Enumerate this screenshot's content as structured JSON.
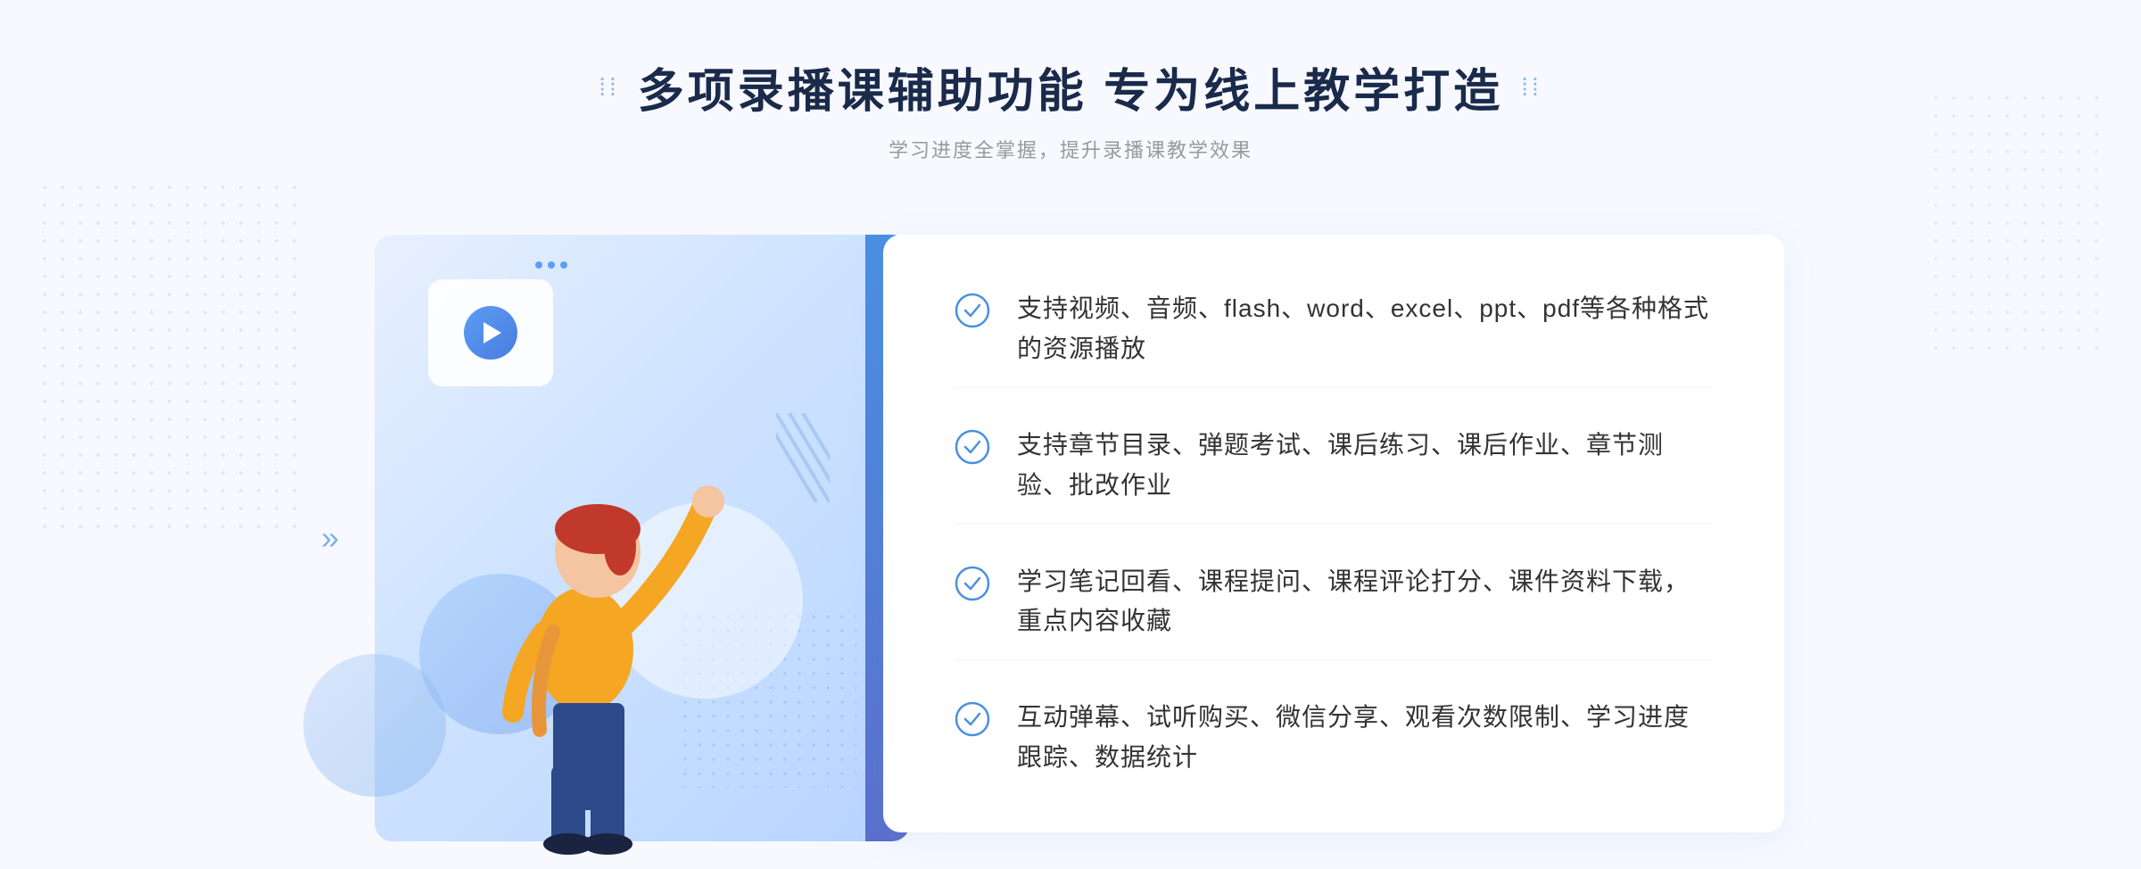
{
  "header": {
    "title": "多项录播课辅助功能 专为线上教学打造",
    "subtitle": "学习进度全掌握，提升录播课教学效果",
    "dots_left": "⁞⁞",
    "dots_right": "⁞⁞"
  },
  "features": [
    {
      "id": 1,
      "text": "支持视频、音频、flash、word、excel、ppt、pdf等各种格式的资源播放"
    },
    {
      "id": 2,
      "text": "支持章节目录、弹题考试、课后练习、课后作业、章节测验、批改作业"
    },
    {
      "id": 3,
      "text": "学习笔记回看、课程提问、课程评论打分、课件资料下载，重点内容收藏"
    },
    {
      "id": 4,
      "text": "互动弹幕、试听购买、微信分享、观看次数限制、学习进度跟踪、数据统计"
    }
  ],
  "colors": {
    "primary_blue": "#4a90e2",
    "dark_text": "#1a2a4a",
    "light_text": "#999999",
    "feature_text": "#333333",
    "check_color": "#4a90e2",
    "bg_color": "#f7f9ff"
  }
}
